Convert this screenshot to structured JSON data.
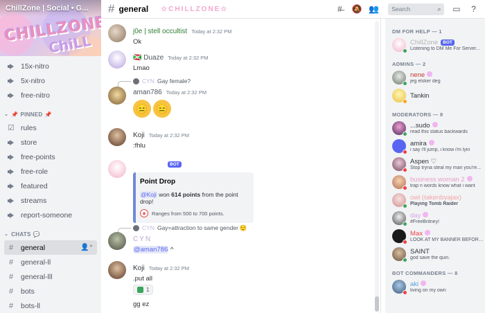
{
  "server": {
    "name": "ChillZone | Social • G..."
  },
  "channels_top": [
    {
      "label": "15x-nitro"
    },
    {
      "label": "5x-nitro"
    },
    {
      "label": "free-nitro"
    }
  ],
  "categories": {
    "pinned": "PINNED",
    "chats": "CHATS"
  },
  "pinned_channels": [
    {
      "label": "rules"
    },
    {
      "label": "store"
    },
    {
      "label": "free-points"
    },
    {
      "label": "free-role"
    },
    {
      "label": "featured"
    },
    {
      "label": "streams"
    },
    {
      "label": "report-someone"
    }
  ],
  "chat_channels": [
    {
      "label": "general"
    },
    {
      "label": "general-ll"
    },
    {
      "label": "general-lll"
    },
    {
      "label": "bots"
    },
    {
      "label": "bots-ll"
    }
  ],
  "header": {
    "channel": "general",
    "topic": "☆CHILLZONE☆"
  },
  "toolbar": {
    "search_placeholder": "Search"
  },
  "messages": {
    "m1": {
      "user": "j0e | stell occultist",
      "time": "Today at 2:32 PM",
      "text": "Ok"
    },
    "m2": {
      "user": "Duaze",
      "time": "Today at 2:32 PM",
      "text": "Lmao"
    },
    "m3": {
      "reply_user": "CYN",
      "reply_text": "Gay female?",
      "user": "aman786",
      "time": "Today at 2:32 PM"
    },
    "m4": {
      "user": "Koji",
      "time": "Today at 2:32 PM",
      "text": ":fhlu"
    },
    "m5": {
      "bot": "BOT",
      "embed_title": "Point Drop",
      "mention": "@Koji",
      "won": "won",
      "points": "614 points",
      "suffix": "from the point drop!",
      "footer": "Ranges from 500 to 700 points."
    },
    "m6": {
      "reply_user": "CYN",
      "reply_text": "Gay=attraction to same gender",
      "user": "CYN",
      "mention": "@aman786",
      "text": "^"
    },
    "m7": {
      "user": "Koji",
      "time": "Today at 2:32 PM",
      "text": ".put all",
      "reaction_count": "1",
      "text2": "gg ez"
    }
  },
  "members": {
    "dm_help": {
      "header": "DM FOR HELP — 1",
      "name": "ChillZone",
      "bot": "BOT",
      "activity": "Listening to DM Me For Server..."
    },
    "admins_header": "ADMINS — 2",
    "admins": [
      {
        "name": "nene",
        "activity": "jeg elsker deg"
      },
      {
        "name": "Tankin",
        "activity": ""
      }
    ],
    "moderators_header": "MODERATORS — 8",
    "moderators": [
      {
        "name": "...sudo",
        "activity": "read this status backwards"
      },
      {
        "name": "amira",
        "activity": "i say i'll jump, i know i'm lyin"
      },
      {
        "name": "Aspen ♡",
        "activity": "Stop tryna steal my man you're..."
      },
      {
        "name": "business woman 2",
        "activity": "trap n words know what i want"
      },
      {
        "name": "owl (takenbyajax)",
        "activity": "Playing Tomb Raider"
      },
      {
        "name": "day",
        "activity": "#FreeBritney!"
      },
      {
        "name": "Max",
        "activity": "LOOK AT MY BANNER BEFORE..."
      },
      {
        "name": "SAINT",
        "activity": "god save the quin."
      }
    ],
    "botcmd_header": "BOT COMMANDERS — 8",
    "botcmd": [
      {
        "name": "aki",
        "activity": "living on my own"
      }
    ]
  },
  "colors": {
    "accent": "#5865f2",
    "online": "#3ba55c",
    "dnd": "#ed4245",
    "idle": "#faa61a",
    "nene": "#c0392b",
    "business": "#e8a0c8",
    "owl": "#f2a6a6",
    "day": "#d8a7e8",
    "max": "#ed4245",
    "cyn": "#bca6d8"
  }
}
